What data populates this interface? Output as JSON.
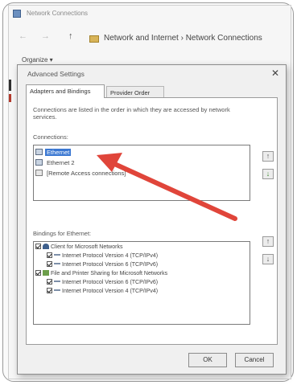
{
  "explorer": {
    "title": "Network Connections",
    "address_path": "Network and Internet  ›  Network Connections",
    "organize": "Organize ▾",
    "nav_back": "←",
    "nav_forward": "→",
    "nav_up": "↑"
  },
  "dialog": {
    "title": "Advanced Settings",
    "close": "✕",
    "tabs": [
      {
        "label": "Adapters and Bindings",
        "active": true
      },
      {
        "label": "Provider Order",
        "active": false
      }
    ],
    "description": "Connections are listed in the order in which they are accessed by network services.",
    "connections_label": "Connections:",
    "connections": [
      {
        "label": "Ethernet",
        "selected": true,
        "icon": "network-adapter-icon"
      },
      {
        "label": "Ethernet 2",
        "selected": false,
        "icon": "network-adapter-icon"
      },
      {
        "label": "[Remote Access connections]",
        "selected": false,
        "icon": "remote-access-icon"
      }
    ],
    "bindings_label": "Bindings for Ethernet:",
    "bindings": [
      {
        "label": "Client for Microsoft Networks",
        "level": 0,
        "icon": "client-icon"
      },
      {
        "label": "Internet Protocol Version 4 (TCP/IPv4)",
        "level": 1,
        "icon": "protocol-icon"
      },
      {
        "label": "Internet Protocol Version 6 (TCP/IPv6)",
        "level": 1,
        "icon": "protocol-icon"
      },
      {
        "label": "File and Printer Sharing for Microsoft Networks",
        "level": 0,
        "icon": "share-icon"
      },
      {
        "label": "Internet Protocol Version 6 (TCP/IPv6)",
        "level": 1,
        "icon": "protocol-icon"
      },
      {
        "label": "Internet Protocol Version 4 (TCP/IPv4)",
        "level": 1,
        "icon": "protocol-icon"
      }
    ],
    "move_up": "↑",
    "move_down": "↓",
    "ok_label": "OK",
    "cancel_label": "Cancel"
  },
  "colors": {
    "selection": "#3b78d2",
    "annotation_arrow": "#e0453a"
  }
}
